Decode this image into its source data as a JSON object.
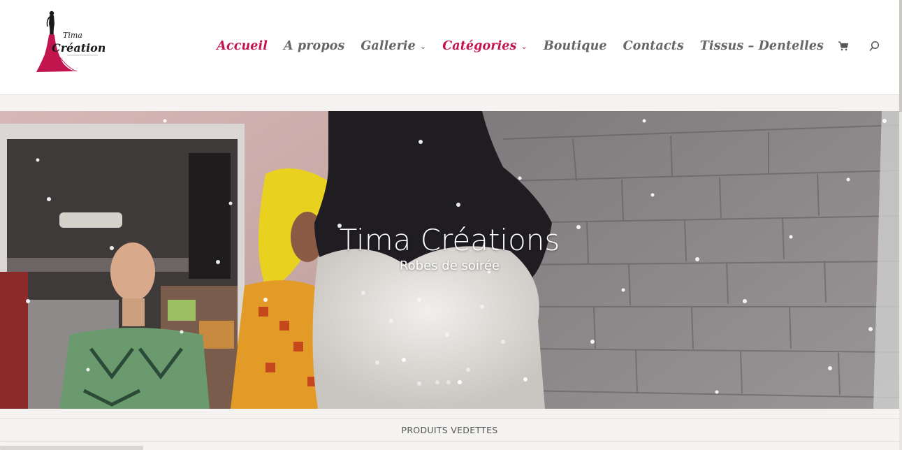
{
  "header": {
    "logo": {
      "name": "Tima Création",
      "icon": "dress-silhouette-logo"
    },
    "nav": [
      {
        "label": "Accueil",
        "active": true,
        "dropdown": false
      },
      {
        "label": "A propos",
        "active": false,
        "dropdown": false
      },
      {
        "label": "Gallerie",
        "active": false,
        "dropdown": true
      },
      {
        "label": "Catégories",
        "active": true,
        "dropdown": true
      },
      {
        "label": "Boutique",
        "active": false,
        "dropdown": false
      },
      {
        "label": "Contacts",
        "active": false,
        "dropdown": false
      },
      {
        "label": "Tissus – Dentelles",
        "active": false,
        "dropdown": false
      }
    ],
    "icons": {
      "cart": "cart-icon",
      "search": "search-icon"
    }
  },
  "hero": {
    "title": "Tima Créations",
    "subtitle": "Robes de soirée",
    "slides": 3,
    "active_slide": 3
  },
  "featured": {
    "label": "PRODUITS VEDETTES"
  },
  "colors": {
    "accent": "#c2154e",
    "nav_text": "#666666",
    "background": "#f4f3f1"
  }
}
